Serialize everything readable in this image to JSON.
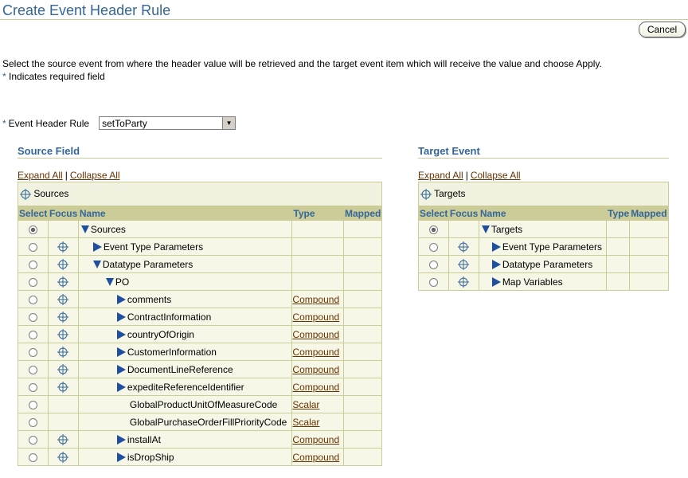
{
  "page": {
    "title": "Create Event Header Rule",
    "cancel_label": "Cancel",
    "instructions": "Select the source event from where the header value will be retrieved and the target event item which will receive the value and choose Apply.",
    "required_marker": "*",
    "required_note": "Indicates required field"
  },
  "event_header_rule": {
    "label": "Event Header Rule",
    "value": "setToParty"
  },
  "source": {
    "title": "Source Field",
    "expand_all": "Expand All",
    "collapse_all": "Collapse All",
    "separator": "|",
    "root_caption": "Sources",
    "columns": {
      "select": "Select",
      "focus": "Focus",
      "name": "Name",
      "type": "Type",
      "mapped": "Mapped"
    },
    "rows": [
      {
        "name": "Sources",
        "type": "",
        "expander": "down",
        "focus": false
      },
      {
        "name": "Event Type Parameters",
        "type": "",
        "expander": "right",
        "focus": true
      },
      {
        "name": "Datatype Parameters",
        "type": "",
        "expander": "down",
        "focus": true
      },
      {
        "name": "PO",
        "type": "",
        "expander": "down",
        "focus": true
      },
      {
        "name": "comments",
        "type": "Compound",
        "expander": "right",
        "focus": true
      },
      {
        "name": "ContractInformation",
        "type": "Compound",
        "expander": "right",
        "focus": true
      },
      {
        "name": "countryOfOrigin",
        "type": "Compound",
        "expander": "right",
        "focus": true
      },
      {
        "name": "CustomerInformation",
        "type": "Compound",
        "expander": "right",
        "focus": true
      },
      {
        "name": "DocumentLineReference",
        "type": "Compound",
        "expander": "right",
        "focus": true
      },
      {
        "name": "expediteReferenceIdentifier",
        "type": "Compound",
        "expander": "right",
        "focus": true
      },
      {
        "name": "GlobalProductUnitOfMeasureCode",
        "type": "Scalar",
        "expander": "none",
        "focus": false
      },
      {
        "name": "GlobalPurchaseOrderFillPriorityCode",
        "type": "Scalar",
        "expander": "none",
        "focus": false
      },
      {
        "name": "installAt",
        "type": "Compound",
        "expander": "right",
        "focus": true
      },
      {
        "name": "isDropShip",
        "type": "Compound",
        "expander": "right",
        "focus": true
      }
    ]
  },
  "target": {
    "title": "Target Event",
    "expand_all": "Expand All",
    "collapse_all": "Collapse All",
    "separator": "|",
    "root_caption": "Targets",
    "columns": {
      "select": "Select",
      "focus": "Focus",
      "name": "Name",
      "type": "Type",
      "mapped": "Mapped"
    },
    "rows": [
      {
        "name": "Targets",
        "expander": "down",
        "focus": false
      },
      {
        "name": "Event Type Parameters",
        "expander": "right",
        "focus": true
      },
      {
        "name": "Datatype Parameters",
        "expander": "right",
        "focus": true
      },
      {
        "name": "Map Variables",
        "expander": "right",
        "focus": true
      }
    ]
  },
  "colors": {
    "accent": "#336699",
    "link": "#663300",
    "header_bg": "#cccc99",
    "cell_bg": "#f7f7e7",
    "expander": "#1f4f9f"
  },
  "icons": {
    "focus": "crosshair-focus-icon",
    "expand": "triangle-right-icon",
    "collapse": "triangle-down-icon"
  }
}
